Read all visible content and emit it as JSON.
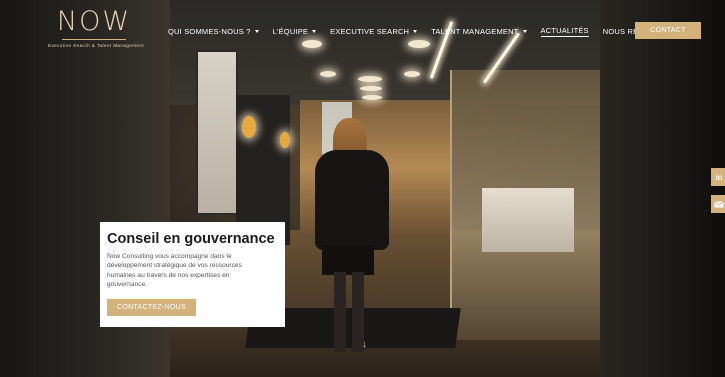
{
  "header": {
    "logo": {
      "wordmark": "NOW",
      "tagline": "Executive Search & Talent Management"
    },
    "nav": [
      {
        "label": "QUI SOMMES-NOUS ?",
        "has_dropdown": true
      },
      {
        "label": "L'ÉQUIPE",
        "has_dropdown": true
      },
      {
        "label": "EXECUTIVE SEARCH",
        "has_dropdown": true
      },
      {
        "label": "TALENT MANAGEMENT",
        "has_dropdown": true
      },
      {
        "label": "ACTUALITÉS",
        "has_dropdown": false,
        "active": true
      },
      {
        "label": "NOUS REJOINDRE",
        "has_dropdown": false
      }
    ],
    "contact_label": "CONTACT"
  },
  "social": {
    "linkedin_label": "in",
    "icons": [
      "linkedin-icon",
      "mail-icon"
    ]
  },
  "hero": {
    "title": "Conseil en gouvernance",
    "text": "Now Consulting vous accompagne dans le développement stratégique de vos ressources humaines au travers de nos expertises en gouvernance.",
    "cta_label": "CONTACTEZ-NOUS"
  },
  "colors": {
    "accent": "#d3b27c",
    "logo": "#e9d6ae",
    "card_bg": "#ffffff",
    "title": "#1b1b1b"
  }
}
